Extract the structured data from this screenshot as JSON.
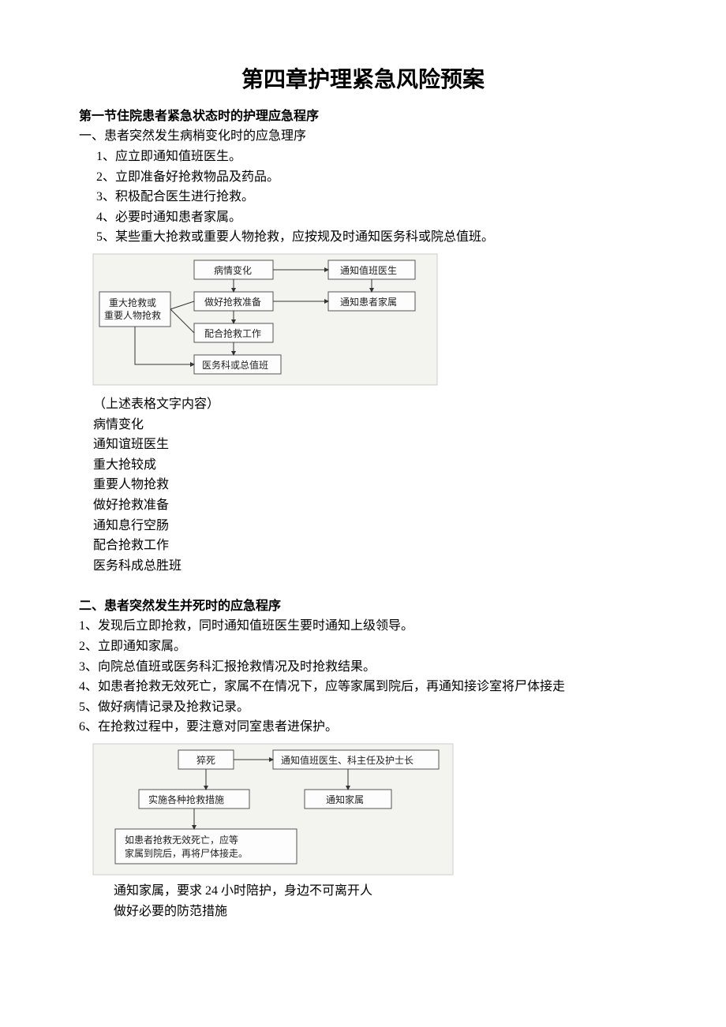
{
  "title": "第四章护理紧急风险预案",
  "section1": {
    "header": "第一节住院患者紧急状态时的护理应急程序",
    "subheader": "一、患者突然发生病梢变化时的应急理序",
    "items": [
      "1、应立即通知值班医生。",
      "2、立即准备好抢救物品及药品。",
      "3、积极配合医生进行抢救。",
      "4、必要时通知患者家属。",
      "5、某些重大抢救或重要人物抢救，应按规及时通知医务科或院总值班。"
    ],
    "flowchart": {
      "b1": "病情变化",
      "b2": "通知值班医生",
      "b3": "做好抢救准备",
      "b4": "通知患者家属",
      "b5": "配合抢救工作",
      "b6": "医务科或总值班",
      "b7a": "重大抢救或",
      "b7b": "重要人物抢救"
    },
    "caption": "（上述表格文字内容）",
    "terms": [
      "病情变化",
      "通知谊班医生",
      "重大抢较成",
      "重要人物抢救",
      "做好抢救准备",
      "通知息行空肠",
      "配合抢救工作",
      "医务科成总胜班"
    ]
  },
  "section2": {
    "header": "二、患者突然发生并死时的应急程序",
    "items": [
      "1、发现后立即抢救，同时通知值班医生要时通知上级领导。",
      "2、立即通知家属。",
      "3、向院总值班或医务科汇报抢救情况及时抢救结果。",
      "4、如患者抢救无效死亡，家属不在情况下，应等家属到院后，再通知接诊室将尸体接走",
      "5、做好病情记录及抢救记录。",
      "6、在抢救过程中，要注意对同室患者进保护。"
    ],
    "flowchart": {
      "b1": "猝死",
      "b2": "通知值班医生、科主任及护士长",
      "b3": "实施各种抢救措施",
      "b4": "通知家属",
      "b5a": "如患者抢救无效死亡，应等",
      "b5b": "家属到院后，再将尸体接走。"
    },
    "tail": [
      "通知家属，要求 24 小时陪护，身边不可离开人",
      "做好必要的防范措施"
    ]
  }
}
